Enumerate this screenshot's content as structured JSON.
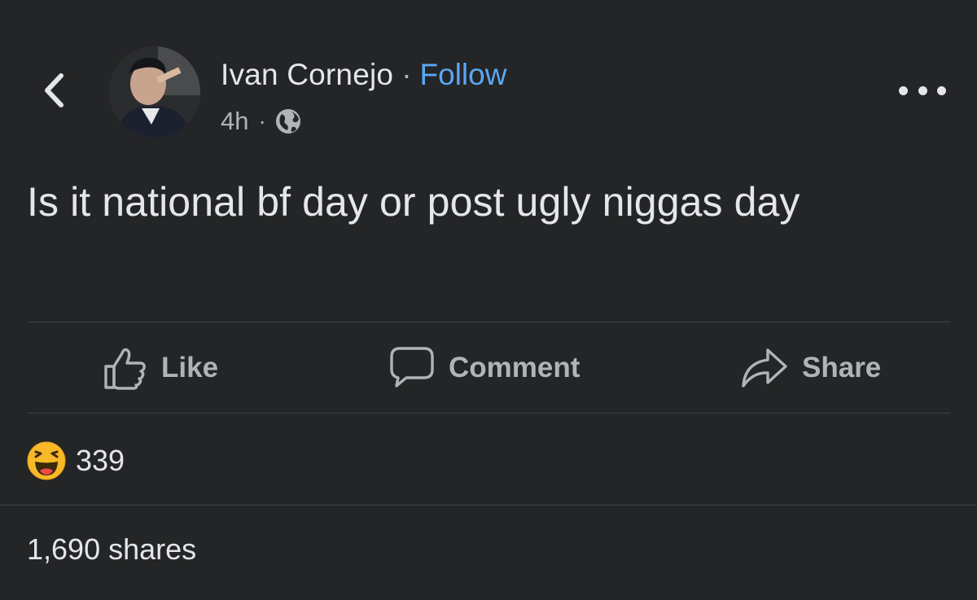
{
  "post": {
    "author_name": "Ivan Cornejo",
    "separator": "·",
    "follow_label": "Follow",
    "time": "4h",
    "meta_separator": "·",
    "privacy_icon": "globe-icon",
    "text": "Is it national bf day or post ugly niggas day"
  },
  "actions": {
    "like_label": "Like",
    "comment_label": "Comment",
    "share_label": "Share"
  },
  "stats": {
    "reaction_icon": "haha-emoji-icon",
    "reaction_count": "339",
    "shares": "1,690 shares"
  },
  "colors": {
    "background": "#242526",
    "accent_link": "#5aa7f5",
    "primary_text": "#e4e6eb",
    "secondary_text": "#b0b3b8"
  }
}
